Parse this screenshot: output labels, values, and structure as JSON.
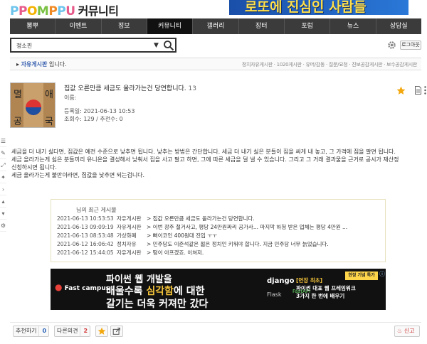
{
  "header": {
    "logo_letters": [
      "P",
      "P",
      "O",
      "M",
      "P",
      "P",
      "U"
    ],
    "logo_korean": "커뮤니티",
    "banner_text": "로또에 진심인 사람들"
  },
  "nav": {
    "items": [
      "뽐뿌",
      "이벤트",
      "정보",
      "커뮤니티",
      "갤러리",
      "장터",
      "포럼",
      "뉴스",
      "상담실"
    ],
    "active_index": 3
  },
  "search": {
    "value": "정소핀",
    "dropdown_icon": "triangle-down-icon",
    "button_icon": "search-icon"
  },
  "user_tools": {
    "settings_icon": "gear-icon",
    "logout_label": "로그아웃"
  },
  "breadcrumb": {
    "board": "자유게시판",
    "suffix": " 입니다.",
    "right_links": "정치자유게시판 · 1020게시판 · 유머/감동 · 질문/요청 · 진보공감게시판 · 보수공감게시판"
  },
  "side_tools": [
    "☰",
    "✎",
    "⤢",
    "✦",
    "›",
    "▴",
    "▾",
    "⚙"
  ],
  "post": {
    "title": "집값 오른만큼 세금도 올라가는건 당연합니다.",
    "comment_count": "13",
    "author_label": "이름:",
    "date_line": "등록일: 2021-06-13 10:53",
    "views_line": "조회수: 129 / 추천수: 0",
    "star_icon": "star-icon",
    "doc_icon": "document-icon",
    "more_icon": "more-vertical-icon",
    "body": [
      "세금을 더 내기 싫다면, 집값은 예전 수준으로 낮추면 됩니다. 낮추는 방법은 간단합니다. 세금 더 내기 싫은 분들이 집을 싸게 내 놓고, 그 가격에 집을 팔면 됩니다.",
      "세금 올라가는게 싫은 분들끼리 유니온을 결성해서 낮춰서 집을 사고 팔고 하면, 그에 따른 세금을 덜 낼 수 있습니다. 그리고 그 거래 결과물을 근거로 공시가 재산정",
      "신청하시면 됩니다.",
      "세금 올라가는게 불만이라면, 집값을 낮추면 되는겁니다."
    ]
  },
  "history": {
    "title": "님의 최근 게시물",
    "rows": [
      {
        "date": "2021-06-13 10:53:53",
        "board": "자유게시판",
        "text": "> 집값 오른만큼 세금도 올라가는건 당연합니다."
      },
      {
        "date": "2021-06-13 09:09:19",
        "board": "자유게시판",
        "text": "> 이번 광주 철거사고, 평당 24만원짜리 공가사... 마지막 하청 받은 업체는 평당 4만원 ..."
      },
      {
        "date": "2021-06-13 08:53:48",
        "board": "가상화폐",
        "text": "> 뻐이코인 400원대 진입 ㅜㅜ"
      },
      {
        "date": "2021-06-12 16:06:42",
        "board": "정치자유",
        "text": "> 민주당도 이준석같은 젊은 정치인 키워야 합니다. 지금 민주당 너무 늙었습니다."
      },
      {
        "date": "2021-06-12 15:44:05",
        "board": "자유게시판",
        "text": "> 떵이 아프겠죠. 이쳐저."
      }
    ]
  },
  "ad": {
    "brand": "Fast campus",
    "line1": "파이썬 웹 개발을",
    "line2_a": "배울수록 ",
    "line2_hl": "심각함",
    "line2_b": "에 대한",
    "line3": "갈기는 더욱 커져만 갔다",
    "tech1": "django",
    "tech2": "Flask",
    "tech3": "FastAPI",
    "badge": "한정 기념 특가",
    "r1": "[연장 최초]",
    "r2": "파이썬 대표 웹 프레임워크",
    "r3": "3가지 한 번에 배우기",
    "close_icon": "ad-info-icon"
  },
  "actions": {
    "recommend_label": "추천하기",
    "recommend_count": "0",
    "opinion_label": "다른의견",
    "opinion_count": "2",
    "star_icon": "star-icon",
    "share_icon": "share-icon",
    "report_label": "신고"
  }
}
